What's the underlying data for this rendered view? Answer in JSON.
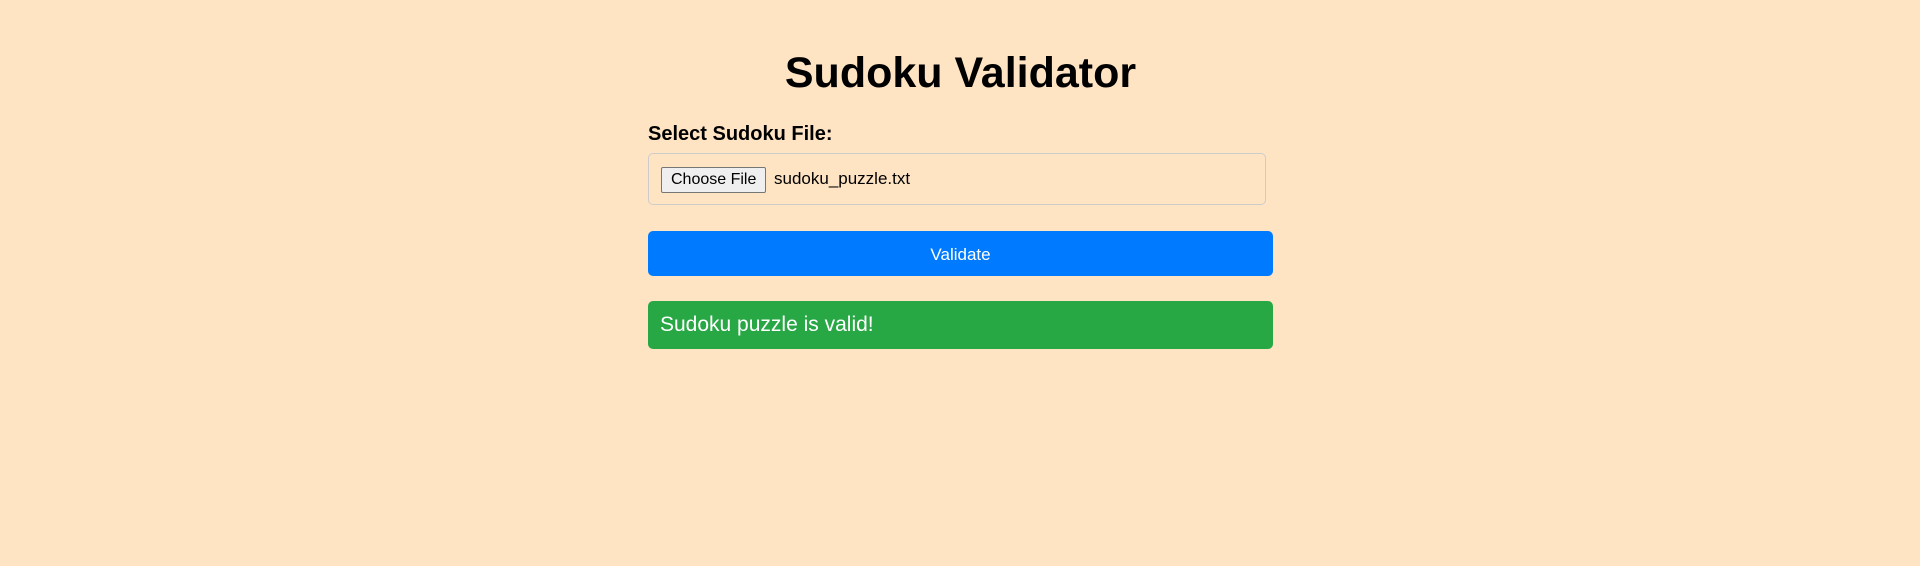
{
  "page": {
    "title": "Sudoku Validator",
    "background_color": "#ffe4c4"
  },
  "form": {
    "file_label": "Select Sudoku File:",
    "choose_file_label": "Choose File",
    "selected_file_name": "sudoku_puzzle.txt",
    "validate_label": "Validate",
    "validate_color": "#007bff"
  },
  "result": {
    "message": "Sudoku puzzle is valid!",
    "status": "valid",
    "color": "#28a745"
  }
}
